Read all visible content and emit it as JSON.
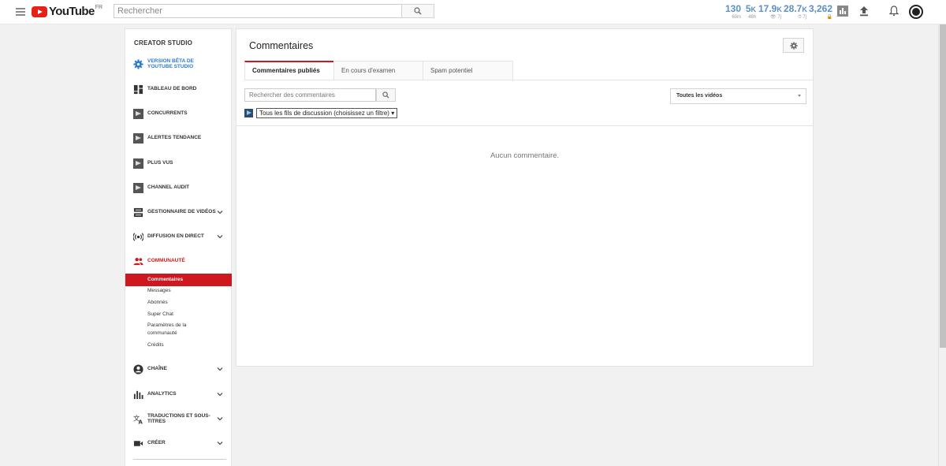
{
  "header": {
    "logo_text": "YouTube",
    "logo_region": "FR",
    "search_placeholder": "Rechercher",
    "stats": [
      {
        "value": "130",
        "unit": "",
        "sub": "60m"
      },
      {
        "value": "5",
        "unit": "K",
        "sub": "48h"
      },
      {
        "value": "17.9",
        "unit": "K",
        "sub": "👁 7j"
      },
      {
        "value": "28.7",
        "unit": "K",
        "sub": "⏱ 7j"
      },
      {
        "value": "3,262",
        "unit": "",
        "sub": "🔒"
      }
    ]
  },
  "sidebar": {
    "title": "CREATOR STUDIO",
    "items": [
      {
        "label": "VERSION BÊTA DE YOUTUBE STUDIO",
        "icon": "gear-icon"
      },
      {
        "label": "TABLEAU DE BORD",
        "icon": "dashboard-icon"
      },
      {
        "label": "CONCURRENTS",
        "icon": "extension-icon"
      },
      {
        "label": "ALERTES TENDANCE",
        "icon": "extension-icon"
      },
      {
        "label": "PLUS VUS",
        "icon": "extension-icon"
      },
      {
        "label": "CHANNEL AUDIT",
        "icon": "extension-icon"
      },
      {
        "label": "GESTIONNAIRE DE VIDÉOS",
        "icon": "video-manager-icon"
      },
      {
        "label": "DIFFUSION EN DIRECT",
        "icon": "live-icon"
      },
      {
        "label": "COMMUNAUTÉ",
        "icon": "community-icon"
      },
      {
        "label": "CHAÎNE",
        "icon": "account-icon"
      },
      {
        "label": "ANALYTICS",
        "icon": "analytics-icon"
      },
      {
        "label": "TRADUCTIONS ET SOUS-TITRES",
        "icon": "translate-icon"
      },
      {
        "label": "CRÉER",
        "icon": "camera-icon"
      }
    ],
    "community_sub": [
      "Commentaires",
      "Messages",
      "Abonnés",
      "Super Chat",
      "Paramètres de la communauté",
      "Crédits"
    ]
  },
  "main": {
    "title": "Commentaires",
    "tabs": [
      "Commentaires publiés",
      "En cours d'examen",
      "Spam potentiel"
    ],
    "search_placeholder": "Rechercher des commentaires",
    "video_filter": "Toutes les vidéos",
    "thread_filter": "Tous les fils de discussion (choisissez un filtre)",
    "empty_message": "Aucun commentaire."
  },
  "colors": {
    "accent_red": "#cc181e",
    "link_blue": "#2b7ad6",
    "stat_blue": "#5b8fc7"
  }
}
